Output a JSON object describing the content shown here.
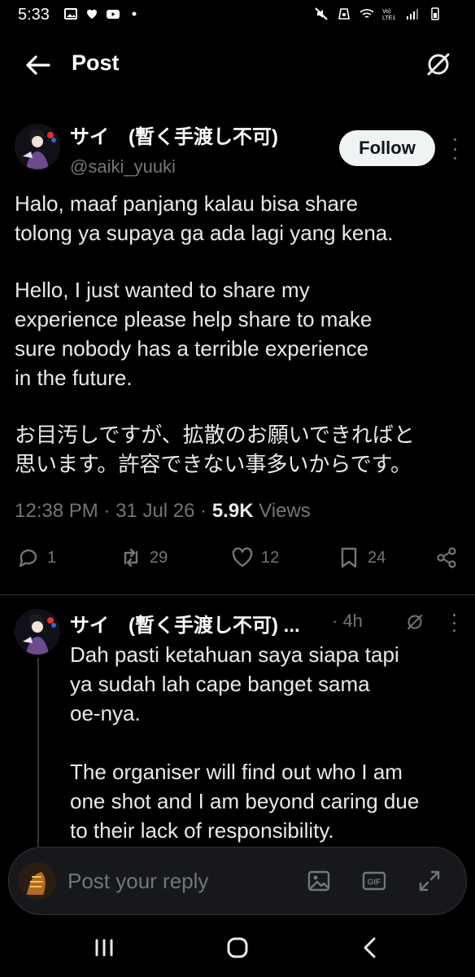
{
  "status_bar": {
    "time": "5:33",
    "icons_left": [
      "gallery-icon",
      "heart-icon",
      "youtube-icon",
      "dot-icon"
    ],
    "icons_right": [
      "mute-icon",
      "recycle-icon",
      "wifi-icon",
      "volte-icon",
      "signal-icon",
      "battery-icon"
    ]
  },
  "header": {
    "title": "Post"
  },
  "post": {
    "author_name": "サイ　(暫く手渡し不可)",
    "handle": "@saiki_yuuki",
    "follow_label": "Follow",
    "paragraphs": [
      [
        "Halo, maaf panjang kalau bisa share",
        "tolong ya supaya ga ada lagi yang kena."
      ],
      [
        "Hello, I just wanted to share my",
        "experience please help share to make",
        "sure nobody has a terrible experience",
        "in the future."
      ],
      [
        "お目汚しですが、拡散のお願いできればと",
        "思います。許容できない事多いからです。"
      ]
    ],
    "time": "12:38 PM",
    "sep": "·",
    "date": "31 Jul 26",
    "views_count": "5.9K",
    "views_label": "Views",
    "stats": {
      "replies": "1",
      "reposts": "29",
      "likes": "12",
      "bookmarks": "24"
    }
  },
  "reply": {
    "author_name": "サイ　(暫く手渡し不可) ...",
    "time": "· 4h",
    "lines_1": [
      "Dah pasti ketahuan saya siapa tapi",
      "ya sudah lah cape banget sama",
      "oe-nya."
    ],
    "lines_2": [
      "The organiser will find out who I am",
      "one shot and I am beyond caring due",
      "to their lack of responsibility."
    ]
  },
  "composer": {
    "placeholder": "Post your reply"
  },
  "colors": {
    "background": "#000000",
    "text": "#e7e9ea",
    "muted": "#71767b",
    "follow_bg": "#eff3f4",
    "divider": "#2f3336"
  }
}
